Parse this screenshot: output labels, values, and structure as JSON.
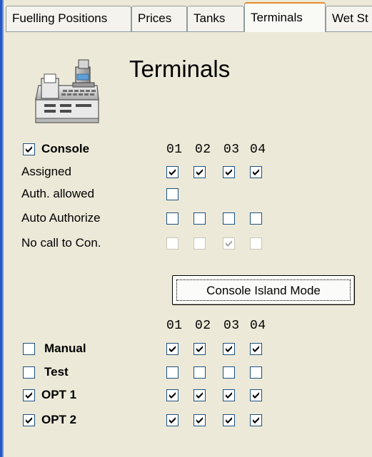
{
  "tabs": [
    "Fuelling Positions",
    "Prices",
    "Tanks",
    "Terminals",
    "Wet St"
  ],
  "active_tab": "Terminals",
  "title": "Terminals",
  "console": {
    "label": "Console",
    "checked": true,
    "columns": [
      "01",
      "02",
      "03",
      "04"
    ],
    "rows": [
      {
        "label": "Assigned",
        "cells": [
          {
            "checked": true,
            "disabled": false
          },
          {
            "checked": true,
            "disabled": false
          },
          {
            "checked": true,
            "disabled": false
          },
          {
            "checked": true,
            "disabled": false
          }
        ]
      },
      {
        "label": "Auth. allowed",
        "cells": [
          {
            "checked": false,
            "disabled": false
          }
        ]
      },
      {
        "label": "Auto Authorize",
        "cells": [
          {
            "checked": false,
            "disabled": false
          },
          {
            "checked": false,
            "disabled": false
          },
          {
            "checked": false,
            "disabled": false
          },
          {
            "checked": false,
            "disabled": false
          }
        ]
      },
      {
        "label": "No call to Con.",
        "cells": [
          {
            "checked": false,
            "disabled": true
          },
          {
            "checked": false,
            "disabled": true
          },
          {
            "checked": true,
            "disabled": true
          },
          {
            "checked": false,
            "disabled": true
          }
        ]
      }
    ]
  },
  "island_button": "Console Island Mode",
  "devices": {
    "columns": [
      "01",
      "02",
      "03",
      "04"
    ],
    "rows": [
      {
        "label": "Manual",
        "checked": false,
        "cells": [
          true,
          true,
          true,
          true
        ]
      },
      {
        "label": "Test",
        "checked": false,
        "cells": [
          false,
          false,
          false,
          false
        ]
      },
      {
        "label": "OPT 1",
        "checked": true,
        "cells": [
          true,
          true,
          true,
          true
        ]
      },
      {
        "label": "OPT 2",
        "checked": true,
        "cells": [
          true,
          true,
          true,
          true
        ]
      }
    ]
  },
  "colors": {
    "check": "#21a121",
    "check_disabled": "#a8a8a0",
    "tab_highlight": "#e68b2c"
  }
}
